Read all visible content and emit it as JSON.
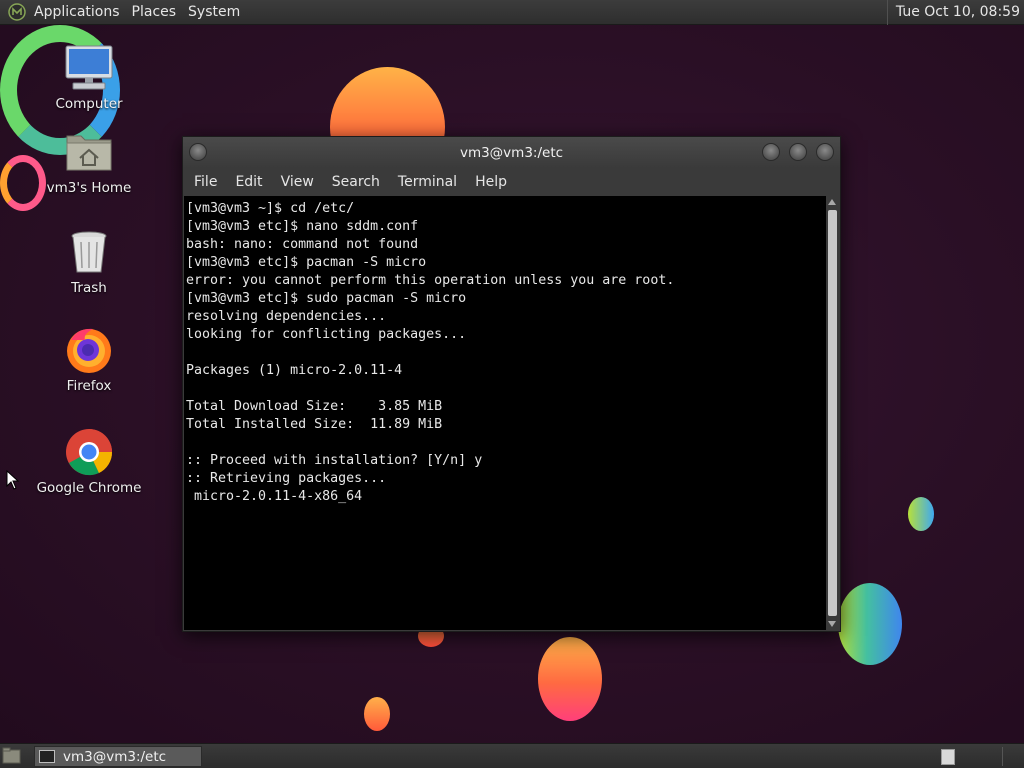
{
  "top_panel": {
    "menus": [
      "Applications",
      "Places",
      "System"
    ],
    "clock": "Tue Oct 10, 08:59"
  },
  "desktop": {
    "icons": [
      {
        "label": "Computer",
        "icon": "computer-icon"
      },
      {
        "label": "vm3's Home",
        "icon": "home-folder-icon"
      },
      {
        "label": "Trash",
        "icon": "trash-icon"
      },
      {
        "label": "Firefox",
        "icon": "firefox-icon"
      },
      {
        "label": "Google Chrome",
        "icon": "chrome-icon"
      }
    ]
  },
  "terminal_window": {
    "title": "vm3@vm3:/etc",
    "menus": [
      "File",
      "Edit",
      "View",
      "Search",
      "Terminal",
      "Help"
    ],
    "output": "[vm3@vm3 ~]$ cd /etc/\n[vm3@vm3 etc]$ nano sddm.conf\nbash: nano: command not found\n[vm3@vm3 etc]$ pacman -S micro\nerror: you cannot perform this operation unless you are root.\n[vm3@vm3 etc]$ sudo pacman -S micro\nresolving dependencies...\nlooking for conflicting packages...\n\nPackages (1) micro-2.0.11-4\n\nTotal Download Size:    3.85 MiB\nTotal Installed Size:  11.89 MiB\n\n:: Proceed with installation? [Y/n] y\n:: Retrieving packages...\n micro-2.0.11-4-x86_64"
  },
  "bottom_panel": {
    "task_label": "vm3@vm3:/etc"
  },
  "colors": {
    "desktop_bg": "#2a0f24",
    "panel_bg": "#333333",
    "terminal_bg": "#000000",
    "terminal_fg": "#e8e8e8"
  }
}
